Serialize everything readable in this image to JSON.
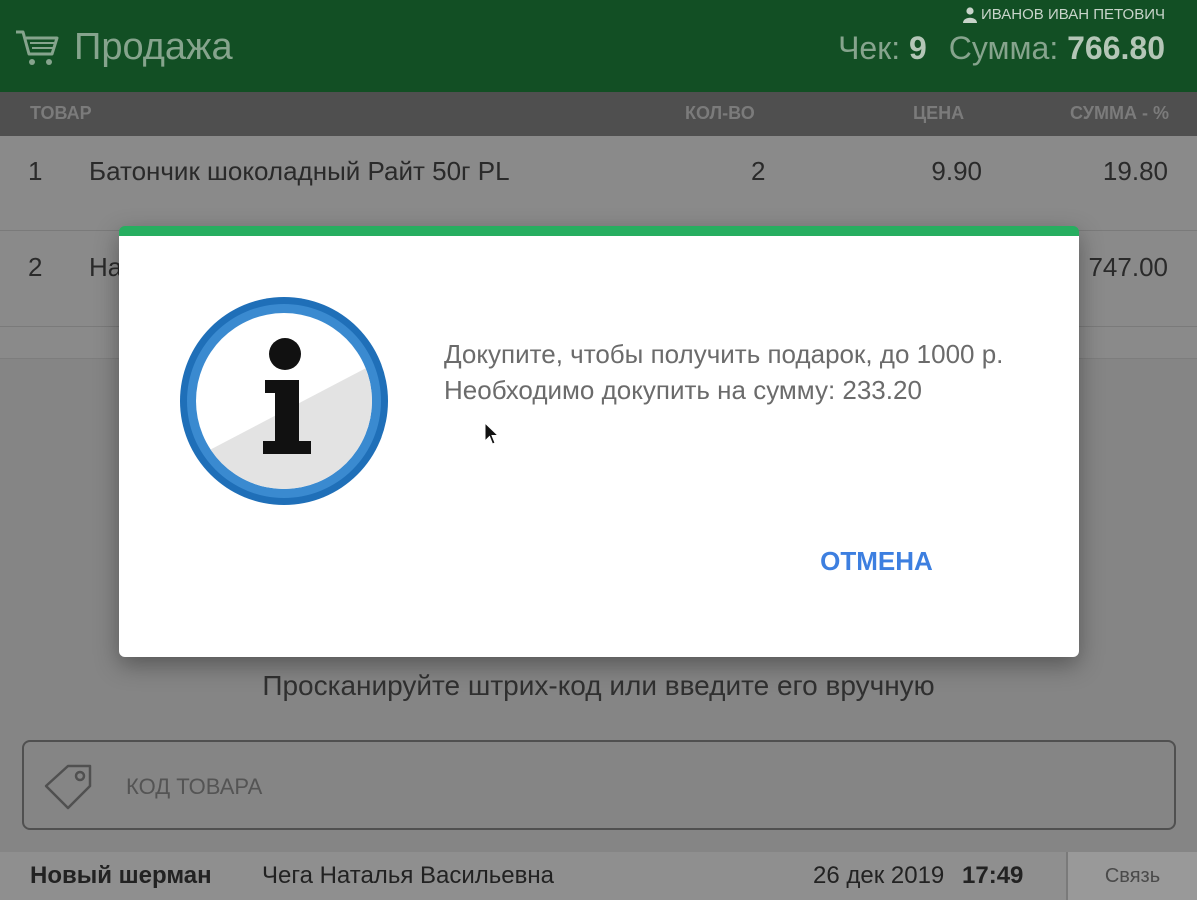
{
  "header": {
    "title": "Продажа",
    "user": "ИВАНОВ ИВАН ПЕТОВИЧ",
    "check_label": "Чек:",
    "check_number": "9",
    "sum_label": "Сумма:",
    "sum_value": "766.80",
    "bg_color": "#124f24"
  },
  "table": {
    "columns": [
      "ТОВАР",
      "КОЛ-ВО",
      "ЦЕНА",
      "СУММА - %"
    ],
    "rows": [
      {
        "num": "1",
        "name": "Батончик шоколадный Райт 50г PL",
        "qty": "2",
        "price": "9.90",
        "sum": "19.80"
      },
      {
        "num": "2",
        "name": "На",
        "qty": "",
        "price": "",
        "sum": "747.00"
      }
    ]
  },
  "scan_hint": "Просканируйте штрих-код или введите его вручную",
  "code_input": {
    "placeholder": "КОД ТОВАРА",
    "icon": "tag-icon"
  },
  "footer": {
    "store": "Новый шерман",
    "cashier": "Чега Наталья Васильевна",
    "date": "26 дек 2019",
    "time": "17:49",
    "link": "Связь"
  },
  "dialog": {
    "message": "Докупите, чтобы получить подарок, до 1000 р. Необходимо докупить на сумму: 233.20",
    "cancel_label": "ОТМЕНА",
    "icon": "info-icon",
    "accent_color": "#27ae60",
    "button_color": "#3d7fe0"
  }
}
